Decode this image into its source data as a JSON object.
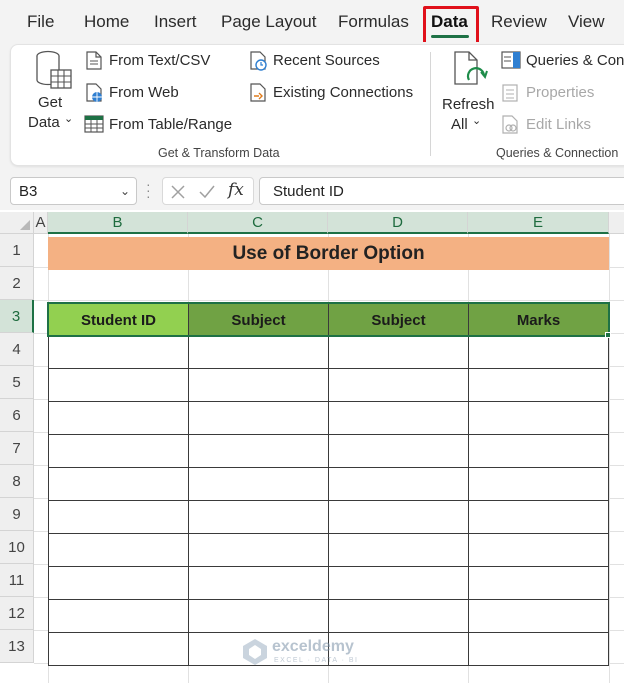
{
  "tabs": [
    {
      "label": "File",
      "active": false
    },
    {
      "label": "Home",
      "active": false
    },
    {
      "label": "Insert",
      "active": false
    },
    {
      "label": "Page Layout",
      "active": false
    },
    {
      "label": "Formulas",
      "active": false
    },
    {
      "label": "Data",
      "active": true
    },
    {
      "label": "Review",
      "active": false
    },
    {
      "label": "View",
      "active": false
    }
  ],
  "ribbon": {
    "get_data": {
      "line1": "Get",
      "line2": "Data",
      "icon": "database-table-icon"
    },
    "from_text_csv": {
      "label": "From Text/CSV",
      "icon": "text-file-icon"
    },
    "from_web": {
      "label": "From Web",
      "icon": "web-page-icon"
    },
    "from_table_range": {
      "label": "From Table/Range",
      "icon": "table-icon"
    },
    "recent_sources": {
      "label": "Recent Sources",
      "icon": "clock-file-icon"
    },
    "existing_connections": {
      "label": "Existing Connections",
      "icon": "connections-file-icon"
    },
    "group1_label": "Get & Transform Data",
    "refresh_all": {
      "line1": "Refresh",
      "line2": "All",
      "icon": "refresh-icon"
    },
    "queries_connections": {
      "label": "Queries & Conn",
      "icon": "queries-pane-icon"
    },
    "properties": {
      "label": "Properties",
      "icon": "properties-icon",
      "disabled": true
    },
    "edit_links": {
      "label": "Edit Links",
      "icon": "edit-links-icon",
      "disabled": true
    },
    "group2_label": "Queries & Connection"
  },
  "formula_bar": {
    "name_box": "B3",
    "fx_label": "fx",
    "value": "Student ID"
  },
  "sheet": {
    "columns": [
      "A",
      "B",
      "C",
      "D",
      "E"
    ],
    "rows": [
      "1",
      "2",
      "3",
      "4",
      "5",
      "6",
      "7",
      "8",
      "9",
      "10",
      "11",
      "12",
      "13"
    ],
    "title": "Use of Border Option",
    "headers": [
      "Student ID",
      "Subject",
      "Subject",
      "Marks"
    ],
    "selected_cell": "B3"
  },
  "colors": {
    "title_fill": "#f4b183",
    "header_fill_selected": "#92d050",
    "header_fill": "#70a244",
    "excel_green": "#1e7145",
    "highlight_red": "#e0101a"
  },
  "watermark": {
    "name": "exceldemy",
    "tagline": "EXCEL · DATA · BI"
  }
}
